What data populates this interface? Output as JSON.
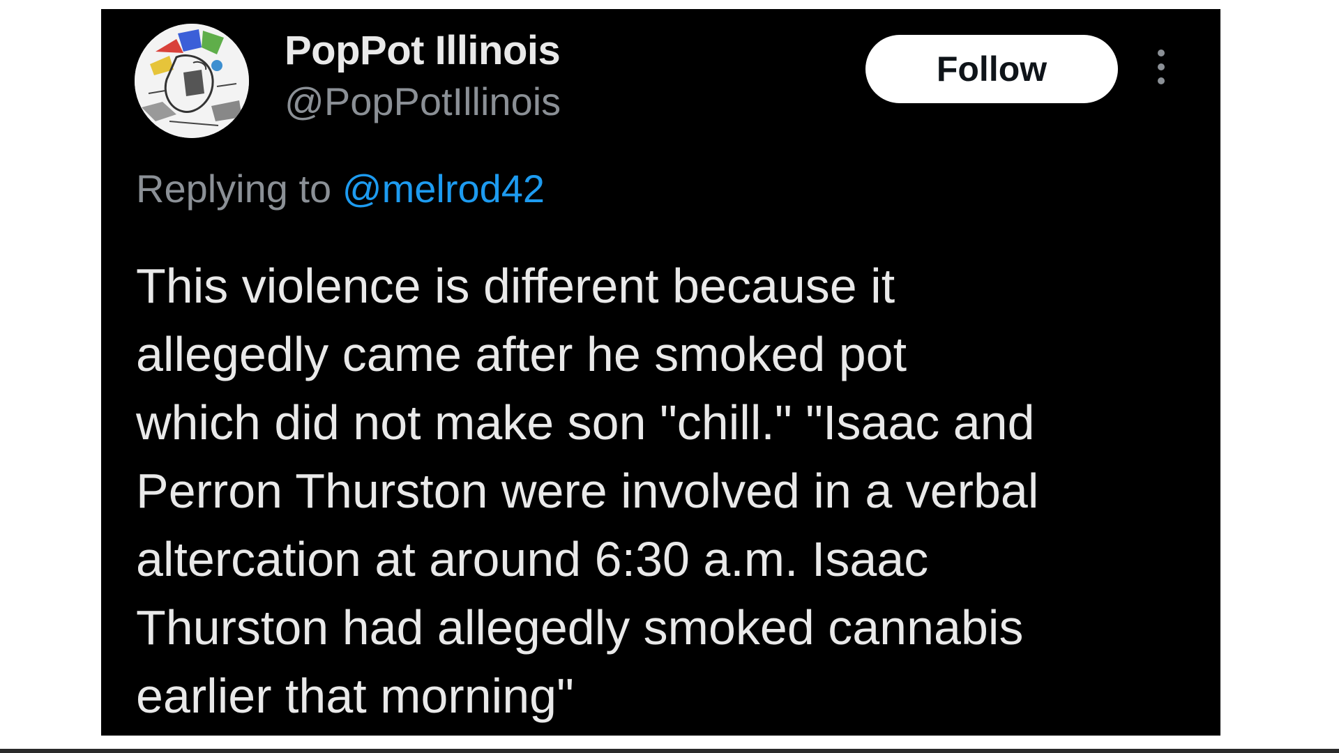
{
  "tweet": {
    "author": {
      "display_name": "PopPot Illinois",
      "handle": "@PopPotIllinois",
      "avatar_icon": "cartoon-collage-avatar"
    },
    "follow_label": "Follow",
    "more_icon": "more-dots-vertical-icon",
    "reply": {
      "prefix": "Replying to",
      "mention": "@melrod42"
    },
    "text_lines": [
      "This violence is different because it",
      "allegedly came after he smoked pot",
      "which did not make son \"chill.\" \"Isaac and",
      "Perron Thurston were involved in a verbal",
      "altercation at around 6:30 a.m. Isaac",
      "Thurston had allegedly smoked cannabis",
      "earlier that morning\""
    ]
  },
  "colors": {
    "background": "#000000",
    "text_primary": "#e9e9e9",
    "text_secondary": "#8b9096",
    "link": "#1d9bf0",
    "button_bg": "#ffffff"
  }
}
